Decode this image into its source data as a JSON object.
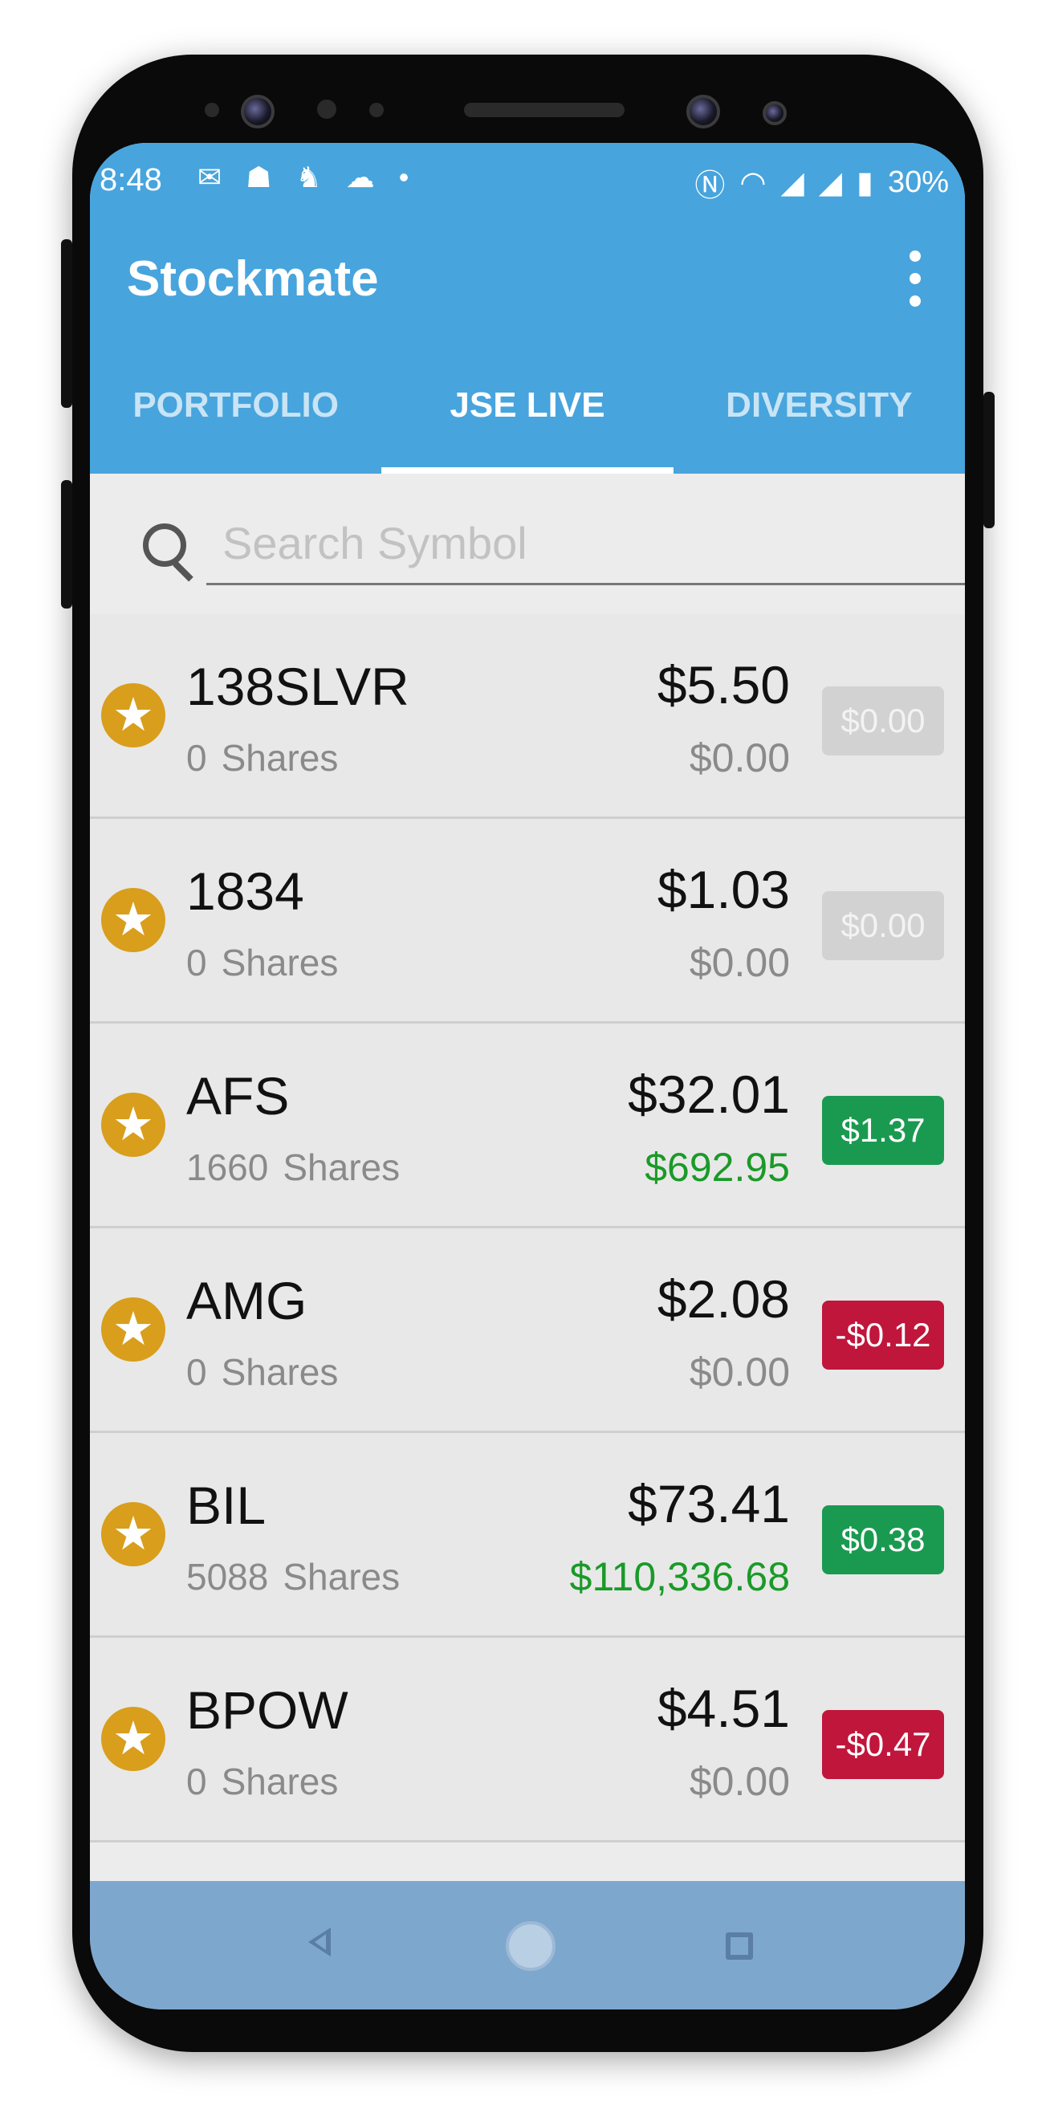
{
  "status_bar": {
    "time": "8:48",
    "notification_icons": [
      "gmail-icon",
      "fitness-icon",
      "app-icon",
      "cloud-icon",
      "dot-icon"
    ],
    "battery": "30%"
  },
  "app_bar": {
    "title": "Stockmate"
  },
  "tabs": [
    {
      "label": "PORTFOLIO",
      "active": false
    },
    {
      "label": "JSE LIVE",
      "active": true
    },
    {
      "label": "DIVERSITY",
      "active": false
    }
  ],
  "search": {
    "placeholder": "Search Symbol"
  },
  "stocks": [
    {
      "symbol": "138SLVR",
      "shares": "0",
      "shares_label": "Shares",
      "price": "$5.50",
      "value": "$0.00",
      "change": "$0.00",
      "change_state": "neutral"
    },
    {
      "symbol": "1834",
      "shares": "0",
      "shares_label": "Shares",
      "price": "$1.03",
      "value": "$0.00",
      "change": "$0.00",
      "change_state": "neutral"
    },
    {
      "symbol": "AFS",
      "shares": "1660",
      "shares_label": "Shares",
      "price": "$32.01",
      "value": "$692.95",
      "change": "$1.37",
      "change_state": "up"
    },
    {
      "symbol": "AMG",
      "shares": "0",
      "shares_label": "Shares",
      "price": "$2.08",
      "value": "$0.00",
      "change": "-$0.12",
      "change_state": "down"
    },
    {
      "symbol": "BIL",
      "shares": "5088",
      "shares_label": "Shares",
      "price": "$73.41",
      "value": "$110,336.68",
      "change": "$0.38",
      "change_state": "up"
    },
    {
      "symbol": "BPOW",
      "shares": "0",
      "shares_label": "Shares",
      "price": "$4.51",
      "value": "$0.00",
      "change": "-$0.47",
      "change_state": "down"
    }
  ],
  "colors": {
    "primary": "#47a4dd",
    "star": "#d89e1c",
    "positive": "#1a9a50",
    "negative": "#c0163c",
    "neutral": "#d2d2d2",
    "value_positive_text": "#1a9a28"
  }
}
